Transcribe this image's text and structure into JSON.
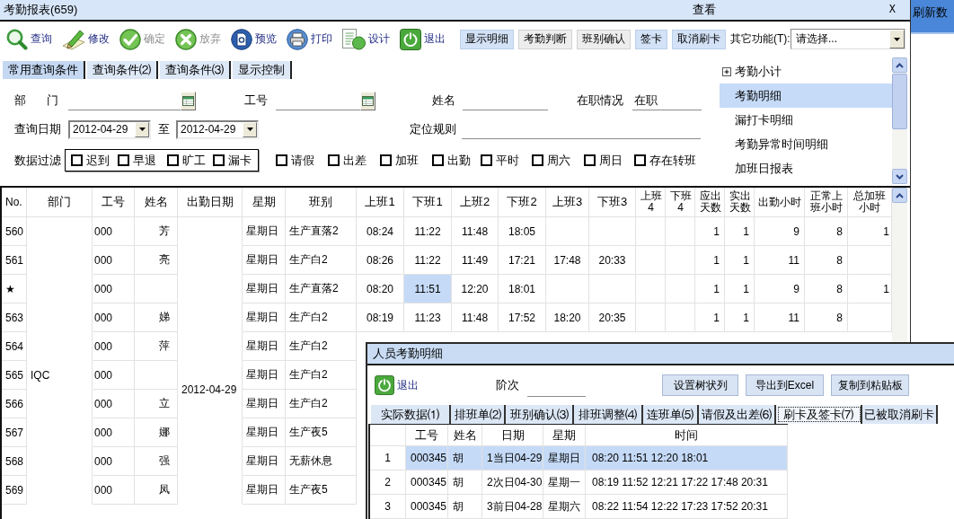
{
  "window": {
    "title": "考勤报表(659)",
    "menu": "查看",
    "close": "X"
  },
  "refresh_strip": {
    "label": "刷新数"
  },
  "toolbar": {
    "tools": [
      {
        "kind": "search",
        "label": "查询",
        "disabled": false
      },
      {
        "kind": "edit",
        "label": "修改",
        "disabled": false
      },
      {
        "kind": "confirm",
        "label": "确定",
        "disabled": true
      },
      {
        "kind": "discard",
        "label": "放弃",
        "disabled": true
      },
      {
        "kind": "preview",
        "label": "预览",
        "disabled": false
      },
      {
        "kind": "print",
        "label": "打印",
        "disabled": false
      },
      {
        "kind": "design",
        "label": "设计",
        "disabled": false
      },
      {
        "kind": "exit",
        "label": "退出",
        "disabled": false
      }
    ],
    "buttons": [
      {
        "label": "显示明细",
        "highlighted": true
      },
      {
        "label": "考勤判断",
        "highlighted": false
      },
      {
        "label": "班别确认",
        "highlighted": false
      },
      {
        "label": "签卡",
        "highlighted": true
      },
      {
        "label": "取消刷卡",
        "highlighted": true
      }
    ],
    "other_functions": {
      "label": "其它功能(T):",
      "value": "请选择..."
    }
  },
  "query_tabs": [
    {
      "label": "常用查询条件",
      "selected": true
    },
    {
      "label": "查询条件⑵",
      "selected": false
    },
    {
      "label": "查询条件⑶",
      "selected": false
    },
    {
      "label": "显示控制",
      "selected": false
    }
  ],
  "query_form": {
    "department": {
      "label": "部　门"
    },
    "employee_id": {
      "label": "工号"
    },
    "name": {
      "label": "姓名"
    },
    "status": {
      "label": "在职情况",
      "value": "在职"
    },
    "date_range": {
      "label": "查询日期",
      "from": "2012-04-29",
      "separator": "至",
      "to": "2012-04-29"
    },
    "locate_rule": {
      "label": "定位规则"
    },
    "filter": {
      "label": "数据过滤",
      "grouped": [
        {
          "label": "迟到",
          "checked": false
        },
        {
          "label": "早退",
          "checked": false
        },
        {
          "label": "旷工",
          "checked": false
        },
        {
          "label": "漏卡",
          "checked": false
        }
      ],
      "options": [
        {
          "label": "请假",
          "checked": false
        },
        {
          "label": "出差",
          "checked": false
        },
        {
          "label": "加班",
          "checked": false
        },
        {
          "label": "出勤",
          "checked": false
        },
        {
          "label": "平时",
          "checked": false
        },
        {
          "label": "周六",
          "checked": false
        },
        {
          "label": "周日",
          "checked": false
        },
        {
          "label": "存在转班",
          "checked": false
        }
      ]
    }
  },
  "report_list": [
    {
      "kind": "group",
      "label": "考勤小计",
      "selected": false,
      "expanded": false
    },
    {
      "kind": "report",
      "label": "考勤明细",
      "selected": true
    },
    {
      "kind": "report",
      "label": "漏打卡明细",
      "selected": false
    },
    {
      "kind": "report",
      "label": "考勤异常时间明细",
      "selected": false
    },
    {
      "kind": "report",
      "label": "加班日报表",
      "selected": false
    }
  ],
  "table": {
    "columns": [
      "No.",
      "部门",
      "工号",
      "姓名",
      "出勤日期",
      "星期",
      "班别",
      "上班1",
      "下班1",
      "上班2",
      "下班2",
      "上班3",
      "下班3",
      "上班4",
      "下班4",
      "应出天数",
      "实出天数",
      "出勤小时",
      "正常上班小时",
      "总加班小时"
    ],
    "department": "IQC",
    "attendance_date": "2012-04-29",
    "rows": [
      {
        "no": "560",
        "employee_id": "000",
        "name": "芳",
        "weekday": "星期日",
        "shift": "生产直落2",
        "punches": [
          {
            "text": "08:24",
            "selected": false
          },
          {
            "text": "11:22",
            "selected": false
          },
          {
            "text": "11:48",
            "selected": false
          },
          {
            "text": "18:05",
            "selected": false
          }
        ],
        "due_days": "1",
        "actual_days": "1",
        "work_hours": "9",
        "normal_hours": "8",
        "overtime_hours": "1"
      },
      {
        "no": "561",
        "employee_id": "000",
        "name": "亮",
        "weekday": "星期日",
        "shift": "生产白2",
        "punches": [
          {
            "text": "08:26",
            "selected": false
          },
          {
            "text": "11:22",
            "selected": false
          },
          {
            "text": "11:49",
            "selected": false
          },
          {
            "text": "17:21",
            "selected": false
          },
          {
            "text": "17:48",
            "selected": false
          },
          {
            "text": "20:33",
            "selected": false
          }
        ],
        "due_days": "1",
        "actual_days": "1",
        "work_hours": "11",
        "normal_hours": "8"
      },
      {
        "no": "★",
        "employee_id": "000",
        "weekday": "星期日",
        "shift": "生产直落2",
        "punches": [
          {
            "text": "08:20",
            "selected": false
          },
          {
            "text": "11:51",
            "selected": true
          },
          {
            "text": "12:20",
            "selected": false
          },
          {
            "text": "18:01",
            "selected": false
          }
        ],
        "due_days": "1",
        "actual_days": "1",
        "work_hours": "9",
        "normal_hours": "8",
        "overtime_hours": "1"
      },
      {
        "no": "563",
        "employee_id": "000",
        "name": "娣",
        "weekday": "星期日",
        "shift": "生产白2",
        "punches": [
          {
            "text": "08:19",
            "selected": false
          },
          {
            "text": "11:23",
            "selected": false
          },
          {
            "text": "11:48",
            "selected": false
          },
          {
            "text": "17:52",
            "selected": false
          },
          {
            "text": "18:20",
            "selected": false
          },
          {
            "text": "20:35",
            "selected": false
          }
        ],
        "due_days": "1",
        "actual_days": "1",
        "work_hours": "11",
        "normal_hours": "8"
      },
      {
        "no": "564",
        "employee_id": "000",
        "name": "萍",
        "weekday": "星期日",
        "shift": "生产白2"
      },
      {
        "no": "565",
        "employee_id": "000",
        "weekday": "星期日",
        "shift": "生产白2"
      },
      {
        "no": "566",
        "employee_id": "000",
        "name": "立",
        "weekday": "星期日",
        "shift": "生产白2"
      },
      {
        "no": "567",
        "employee_id": "000",
        "name": "娜",
        "weekday": "星期日",
        "shift": "生产夜5"
      },
      {
        "no": "568",
        "employee_id": "000",
        "name": "强",
        "weekday": "星期日",
        "shift": "无薪休息"
      },
      {
        "no": "569",
        "employee_id": "000",
        "name": "凤",
        "weekday": "星期日",
        "shift": "生产夜5"
      }
    ]
  },
  "detail_dialog": {
    "title": "人员考勤明细",
    "exit_label": "退出",
    "level_label": "阶次",
    "buttons": [
      "设置树状列",
      "导出到Excel",
      "复制到粘贴板"
    ],
    "tabs": [
      {
        "label": "实际数据⑴",
        "selected": false
      },
      {
        "label": "排班单⑵",
        "selected": false
      },
      {
        "label": "班别确认⑶",
        "selected": false
      },
      {
        "label": "排班调整⑷",
        "selected": false
      },
      {
        "label": "连班单⑸",
        "selected": false
      },
      {
        "label": "请假及出差⑹",
        "selected": false
      },
      {
        "label": "刷卡及签卡⑺",
        "selected": true
      },
      {
        "label": "已被取消刷卡",
        "selected": false
      }
    ],
    "columns": [
      "工号",
      "姓名",
      "日期",
      "星期",
      "时间"
    ],
    "rows": [
      {
        "no": "1",
        "employee_id": "000345",
        "name": "胡",
        "date": "1当日04-29",
        "weekday": "星期日",
        "times": "08:20 11:51 12:20 18:01",
        "selected": true
      },
      {
        "no": "2",
        "employee_id": "000345",
        "name": "胡",
        "date": "2次日04-30",
        "weekday": "星期一",
        "times": "08:19 11:52 12:21 17:22 17:48 20:31",
        "selected": false
      },
      {
        "no": "3",
        "employee_id": "000345",
        "name": "胡",
        "date": "3前日04-28",
        "weekday": "星期六",
        "times": "08:22 11:54 12:22 17:23 17:52 20:31",
        "selected": false
      }
    ]
  }
}
